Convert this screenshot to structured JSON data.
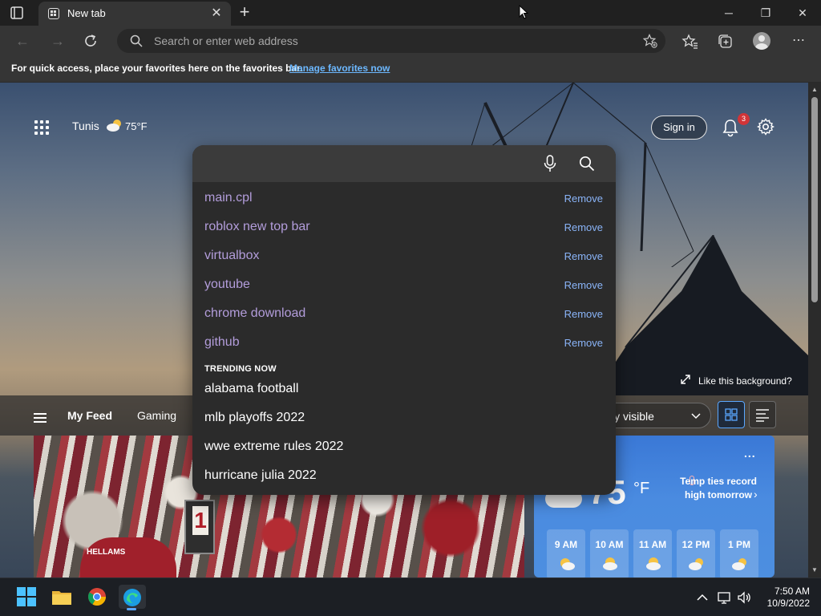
{
  "browser": {
    "tab_title": "New tab",
    "address_placeholder": "Search or enter web address"
  },
  "favorites_bar": {
    "message": "For quick access, place your favorites here on the favorites bar.",
    "link": "Manage favorites now"
  },
  "ntp": {
    "weather_location": "Tunis",
    "weather_temp": "75°F",
    "sign_in": "Sign in",
    "notification_count": "3",
    "like_background": "Like this background?"
  },
  "feed": {
    "tabs": [
      "My Feed",
      "Gaming"
    ],
    "visibility_label": "ly visible",
    "player_name": "HELLAMS",
    "score_digit": "1"
  },
  "weather_card": {
    "more": "...",
    "temperature": "75",
    "unit": "°F",
    "alert": "Temp ties record high tomorrow",
    "hours": [
      "9 AM",
      "10 AM",
      "11 AM",
      "12 PM",
      "1 PM"
    ]
  },
  "search_dropdown": {
    "history": [
      {
        "text": "main.cpl",
        "action": "Remove"
      },
      {
        "text": "roblox new top bar",
        "action": "Remove"
      },
      {
        "text": "virtualbox",
        "action": "Remove"
      },
      {
        "text": "youtube",
        "action": "Remove"
      },
      {
        "text": "chrome download",
        "action": "Remove"
      },
      {
        "text": "github",
        "action": "Remove"
      }
    ],
    "trending_title": "TRENDING NOW",
    "trending": [
      "alabama football",
      "mlb playoffs 2022",
      "wwe extreme rules 2022",
      "hurricane julia 2022"
    ]
  },
  "taskbar": {
    "time": "7:50 AM",
    "date": "10/9/2022"
  },
  "colors": {
    "accent": "#5aa7ff",
    "history_link": "#b39ddb",
    "remove_link": "#8ab4f8",
    "badge": "#d13438"
  }
}
